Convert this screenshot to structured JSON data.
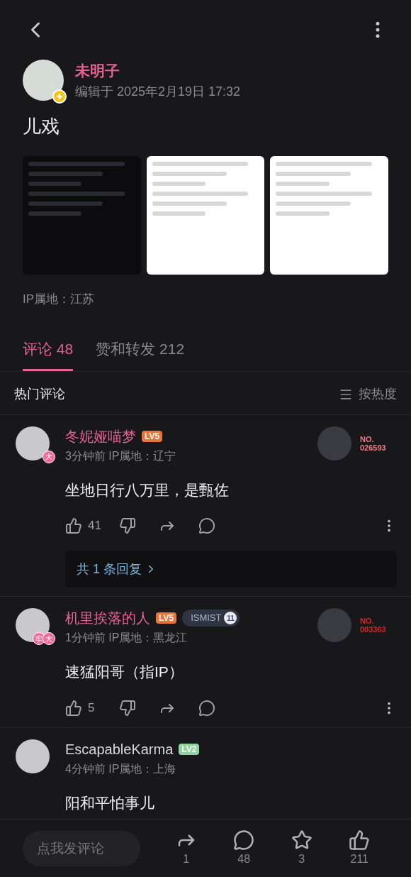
{
  "post": {
    "author": "未明子",
    "edited": "编辑于 2025年2月19日 17:32",
    "title": "儿戏",
    "images": [
      {
        "kind": "dark"
      },
      {
        "kind": "light"
      },
      {
        "kind": "light"
      }
    ],
    "ip": "IP属地：江苏"
  },
  "tabs": [
    {
      "label": "评论 48",
      "selected": true
    },
    {
      "label": "赞和转发 212",
      "selected": false
    }
  ],
  "comments_header": {
    "title": "热门评论",
    "sort": "按热度"
  },
  "comments": [
    {
      "name": "冬妮娅喵梦",
      "level": "LV5",
      "color": "#e8743b",
      "avatar_badges": [
        "大"
      ],
      "time": "3分钟前 IP属地：辽宁",
      "text": "坐地日行八万里，是甄佐",
      "fan_card": {
        "label": "NO.",
        "number": "026593",
        "color": "#f07a86"
      },
      "likes": "41",
      "replies": "共 1 条回复"
    },
    {
      "name": "机里挨落的人",
      "level": "LV5",
      "color": "#e8743b",
      "medal": {
        "label": "ISMIST",
        "count": "11"
      },
      "avatar_badges": [
        "牢",
        "大"
      ],
      "time": "1分钟前 IP属地：黑龙江",
      "text": "速猛阳哥（指IP）",
      "fan_card": {
        "label": "NO.",
        "number": "003363",
        "color": "#d42a2a"
      },
      "likes": "5"
    },
    {
      "name": "EscapableKarma",
      "level": "LV2",
      "color": "#8fd3a0",
      "time": "4分钟前 IP属地：上海",
      "text": "阳和平怕事儿"
    }
  ],
  "bottom_bar": {
    "placeholder": "点我发评论",
    "share": "1",
    "comments": "48",
    "favorites": "3",
    "likes": "211"
  }
}
